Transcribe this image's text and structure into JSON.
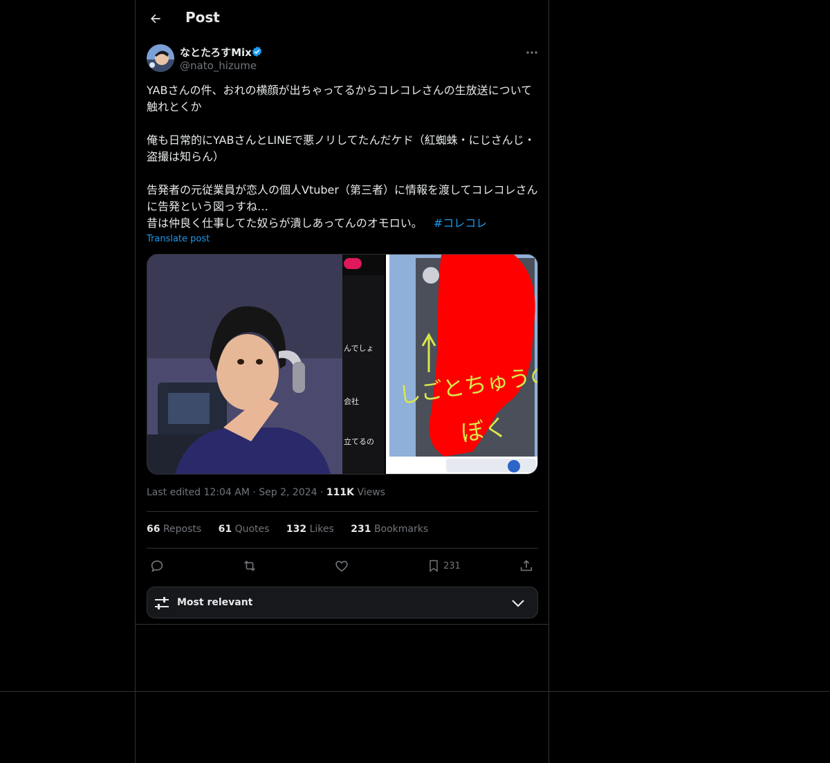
{
  "header": {
    "title": "Post"
  },
  "author": {
    "name": "なとたろすMix",
    "handle": "@nato_hizume"
  },
  "tweet": {
    "paragraphs": [
      "YABさんの件、おれの横顔が出ちゃってるからコレコレさんの生放送について触れとくか",
      "俺も日常的にYABさんとLINEで悪ノリしてたんだケド（紅蜘蛛・にじさんじ・盗撮は知らん）",
      "告発者の元従業員が恋人の個人Vtuber（第三者）に情報を渡してコレコレさんに告発という図っすね…",
      "昔は仲良く仕事してた奴らが潰しあってんのオモロい。"
    ],
    "hashtag": "#コレコレ",
    "translate": "Translate post"
  },
  "media": {
    "middle_texts": [
      "んでしょ",
      "会社",
      "立てるの"
    ],
    "handwriting_line1": "しごとちゅうの",
    "handwriting_line2": "ぼく"
  },
  "meta": {
    "edited": "Last edited 12:04 AM",
    "date": "Sep 2, 2024",
    "views_count": "111K",
    "views_label": "Views"
  },
  "stats": {
    "reposts_count": "66",
    "reposts_label": "Reposts",
    "quotes_count": "61",
    "quotes_label": "Quotes",
    "likes_count": "132",
    "likes_label": "Likes",
    "bookmarks_count": "231",
    "bookmarks_label": "Bookmarks"
  },
  "actions": {
    "bookmark_count": "231"
  },
  "sort": {
    "label": "Most relevant"
  },
  "colors": {
    "accent": "#1d9bf0",
    "background": "#000000",
    "border": "#2f3336",
    "muted": "#71767b"
  },
  "icons": [
    "back-arrow-icon",
    "verified-badge-icon",
    "more-icon",
    "reply-icon",
    "repost-icon",
    "like-icon",
    "bookmark-icon",
    "share-icon",
    "sliders-icon",
    "chevron-down-icon"
  ]
}
